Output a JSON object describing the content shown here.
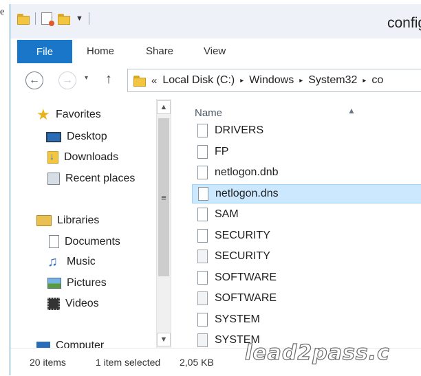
{
  "page_edge_text": "e",
  "window": {
    "title": "config"
  },
  "ribbon": {
    "tabs": [
      {
        "label": "File",
        "active": true
      },
      {
        "label": "Home"
      },
      {
        "label": "Share"
      },
      {
        "label": "View"
      }
    ]
  },
  "quick_access": {
    "icons": [
      "folder-icon",
      "properties-icon",
      "new-folder-icon",
      "customize-dropdown-icon"
    ]
  },
  "navigation": {
    "back_icon": "back-arrow-icon",
    "forward_icon": "forward-arrow-icon",
    "recent_dropdown": "▾",
    "up_icon": "up-arrow-icon",
    "address": {
      "overflow": "«",
      "crumbs": [
        "Local Disk (C:)",
        "Windows",
        "System32",
        "co"
      ],
      "separator": "▸"
    }
  },
  "nav_pane": {
    "favorites": {
      "label": "Favorites",
      "items": [
        {
          "label": "Desktop",
          "icon": "desktop-icon"
        },
        {
          "label": "Downloads",
          "icon": "downloads-icon"
        },
        {
          "label": "Recent places",
          "icon": "recent-places-icon"
        }
      ]
    },
    "libraries": {
      "label": "Libraries",
      "items": [
        {
          "label": "Documents",
          "icon": "documents-icon"
        },
        {
          "label": "Music",
          "icon": "music-icon"
        },
        {
          "label": "Pictures",
          "icon": "pictures-icon"
        },
        {
          "label": "Videos",
          "icon": "videos-icon"
        }
      ]
    },
    "computer": {
      "label": "Computer"
    }
  },
  "file_list": {
    "column_header": "Name",
    "files": [
      {
        "name": "DRIVERS",
        "icon": "file-icon",
        "selected": false
      },
      {
        "name": "FP",
        "icon": "file-icon",
        "selected": false
      },
      {
        "name": "netlogon.dnb",
        "icon": "file-icon",
        "selected": false
      },
      {
        "name": "netlogon.dns",
        "icon": "file-icon",
        "selected": true
      },
      {
        "name": "SAM",
        "icon": "file-icon",
        "selected": false
      },
      {
        "name": "SECURITY",
        "icon": "file-icon",
        "selected": false
      },
      {
        "name": "SECURITY",
        "icon": "system-file-icon",
        "selected": false
      },
      {
        "name": "SOFTWARE",
        "icon": "file-icon",
        "selected": false
      },
      {
        "name": "SOFTWARE",
        "icon": "system-file-icon",
        "selected": false
      },
      {
        "name": "SYSTEM",
        "icon": "file-icon",
        "selected": false
      },
      {
        "name": "SYSTEM",
        "icon": "system-file-icon",
        "selected": false
      }
    ]
  },
  "status_bar": {
    "item_count": "20 items",
    "selection": "1 item selected",
    "size": "2,05 KB"
  },
  "watermark": "lead2pass.c",
  "colors": {
    "accent": "#1976c8",
    "selection_bg": "#cce8ff",
    "selection_border": "#99d1ff",
    "folder": "#f2c640"
  }
}
